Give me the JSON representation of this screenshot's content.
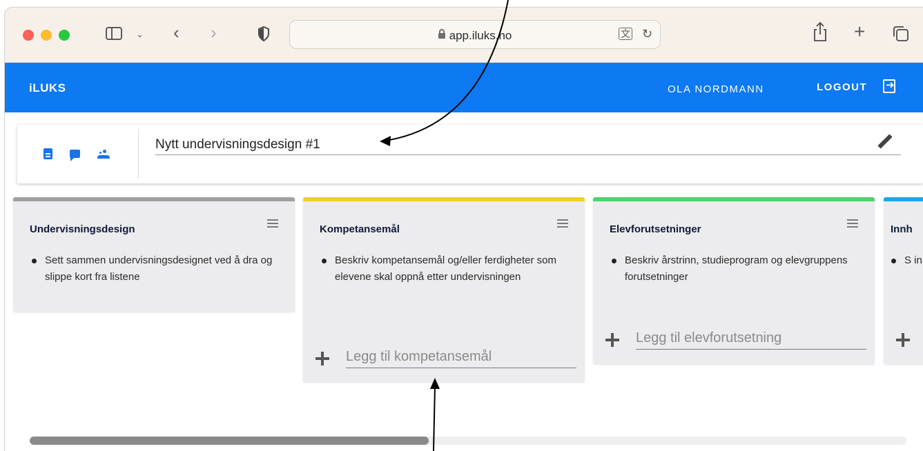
{
  "browser": {
    "url": "app.iluks.no"
  },
  "app": {
    "logo": "iLUKS",
    "user_name": "OLA NORDMANN",
    "logout_label": "LOGOUT"
  },
  "design": {
    "title": "Nytt undervisningsdesign #1"
  },
  "columns": [
    {
      "title": "Undervisningsdesign",
      "accent": "#a0a0a0",
      "bullets": [
        "Sett sammen undervisningsdesignet ved å dra og slippe kort fra listene"
      ]
    },
    {
      "title": "Kompetansemål",
      "accent": "#f2d024",
      "bullets": [
        "Beskriv kompetansemål og/eller ferdigheter som elevene skal oppnå etter undervisningen"
      ],
      "add_placeholder": "Legg til kompetansemål"
    },
    {
      "title": "Elevforutsetninger",
      "accent": "#4cd36a",
      "bullets": [
        "Beskriv årstrinn, studieprogram og elevgruppens forutsetninger"
      ],
      "add_placeholder": "Legg til elevforutsetning"
    },
    {
      "title": "Innh",
      "accent": "#1ea5ea",
      "bullets": [
        "S in"
      ]
    }
  ],
  "colors": {
    "appbar": "#0d79f2",
    "icon_accent": "#1a73e8"
  },
  "icons": [
    "sidebar-toggle-icon",
    "chevron-down-icon",
    "back-icon",
    "forward-icon",
    "shield-icon",
    "lock-icon",
    "translate-icon",
    "reload-icon",
    "share-icon",
    "new-tab-icon",
    "tabs-overview-icon",
    "logout-icon",
    "document-icon",
    "chat-icon",
    "people-icon",
    "pencil-icon",
    "menu-icon",
    "plus-icon"
  ]
}
